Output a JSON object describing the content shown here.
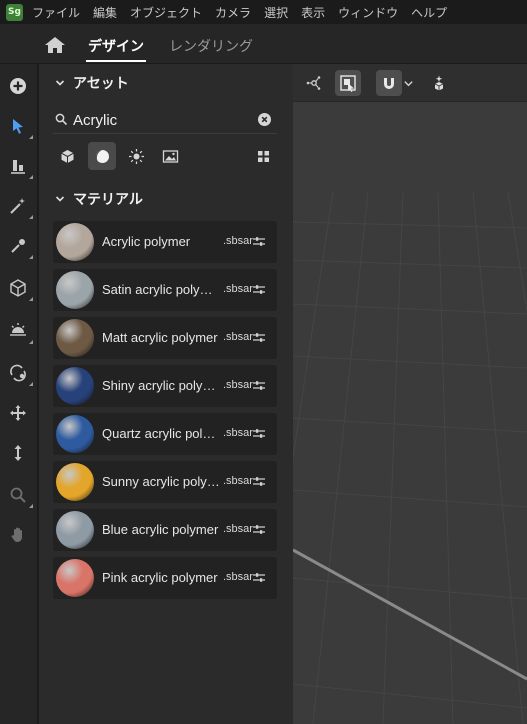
{
  "app": {
    "logo_text": "Sg"
  },
  "menu": [
    "ファイル",
    "編集",
    "オブジェクト",
    "カメラ",
    "選択",
    "表示",
    "ウィンドウ",
    "ヘルプ"
  ],
  "tabs": {
    "design": "デザイン",
    "rendering": "レンダリング",
    "active": "design"
  },
  "toolbar": {
    "tools": [
      "add-icon",
      "select-arrow-icon",
      "align-icon",
      "magic-wand-icon",
      "eyedropper-icon",
      "cube-icon",
      "light-icon",
      "transform-icon",
      "move-icon",
      "vertical-move-icon",
      "zoom-icon",
      "hand-icon"
    ],
    "active_tool": "select-arrow-icon"
  },
  "assets_panel": {
    "title": "アセット",
    "search": {
      "value": "Acrylic",
      "placeholder": ""
    },
    "filters": [
      "model-icon",
      "material-icon",
      "light-icon",
      "image-icon"
    ],
    "active_filter": "material-icon",
    "view_toggle": "grid-icon",
    "section_title": "マテリアル",
    "materials": [
      {
        "name": "Acrylic polymer",
        "format": ".sbsar",
        "color": "#b3a69b"
      },
      {
        "name": "Satin acrylic polymer",
        "format": ".sbsar",
        "color": "#9ba4a8"
      },
      {
        "name": "Matt acrylic polymer",
        "format": ".sbsar",
        "color": "#6e5a44"
      },
      {
        "name": "Shiny acrylic polymer",
        "format": ".sbsar",
        "color": "#27427a"
      },
      {
        "name": "Quartz acrylic polymer",
        "format": ".sbsar",
        "color": "#2e5aa0"
      },
      {
        "name": "Sunny acrylic polymer",
        "format": ".sbsar",
        "color": "#e3a52a"
      },
      {
        "name": "Blue acrylic polymer",
        "format": ".sbsar",
        "color": "#8e9aa4"
      },
      {
        "name": "Pink acrylic polymer",
        "format": ".sbsar",
        "color": "#d97468"
      }
    ]
  },
  "viewport": {
    "tools": [
      "scene-graph-icon",
      "frame-selection-icon",
      "snap-magnet-icon",
      "chevron-down-icon",
      "smart-placement-icon"
    ],
    "active_tools": [
      "frame-selection-icon",
      "snap-magnet-icon"
    ]
  },
  "colors": {
    "accent": "#4f9ff0",
    "background": "#1d1d1d",
    "panel": "#2b2b2b",
    "viewport": "#3b3b3b"
  }
}
